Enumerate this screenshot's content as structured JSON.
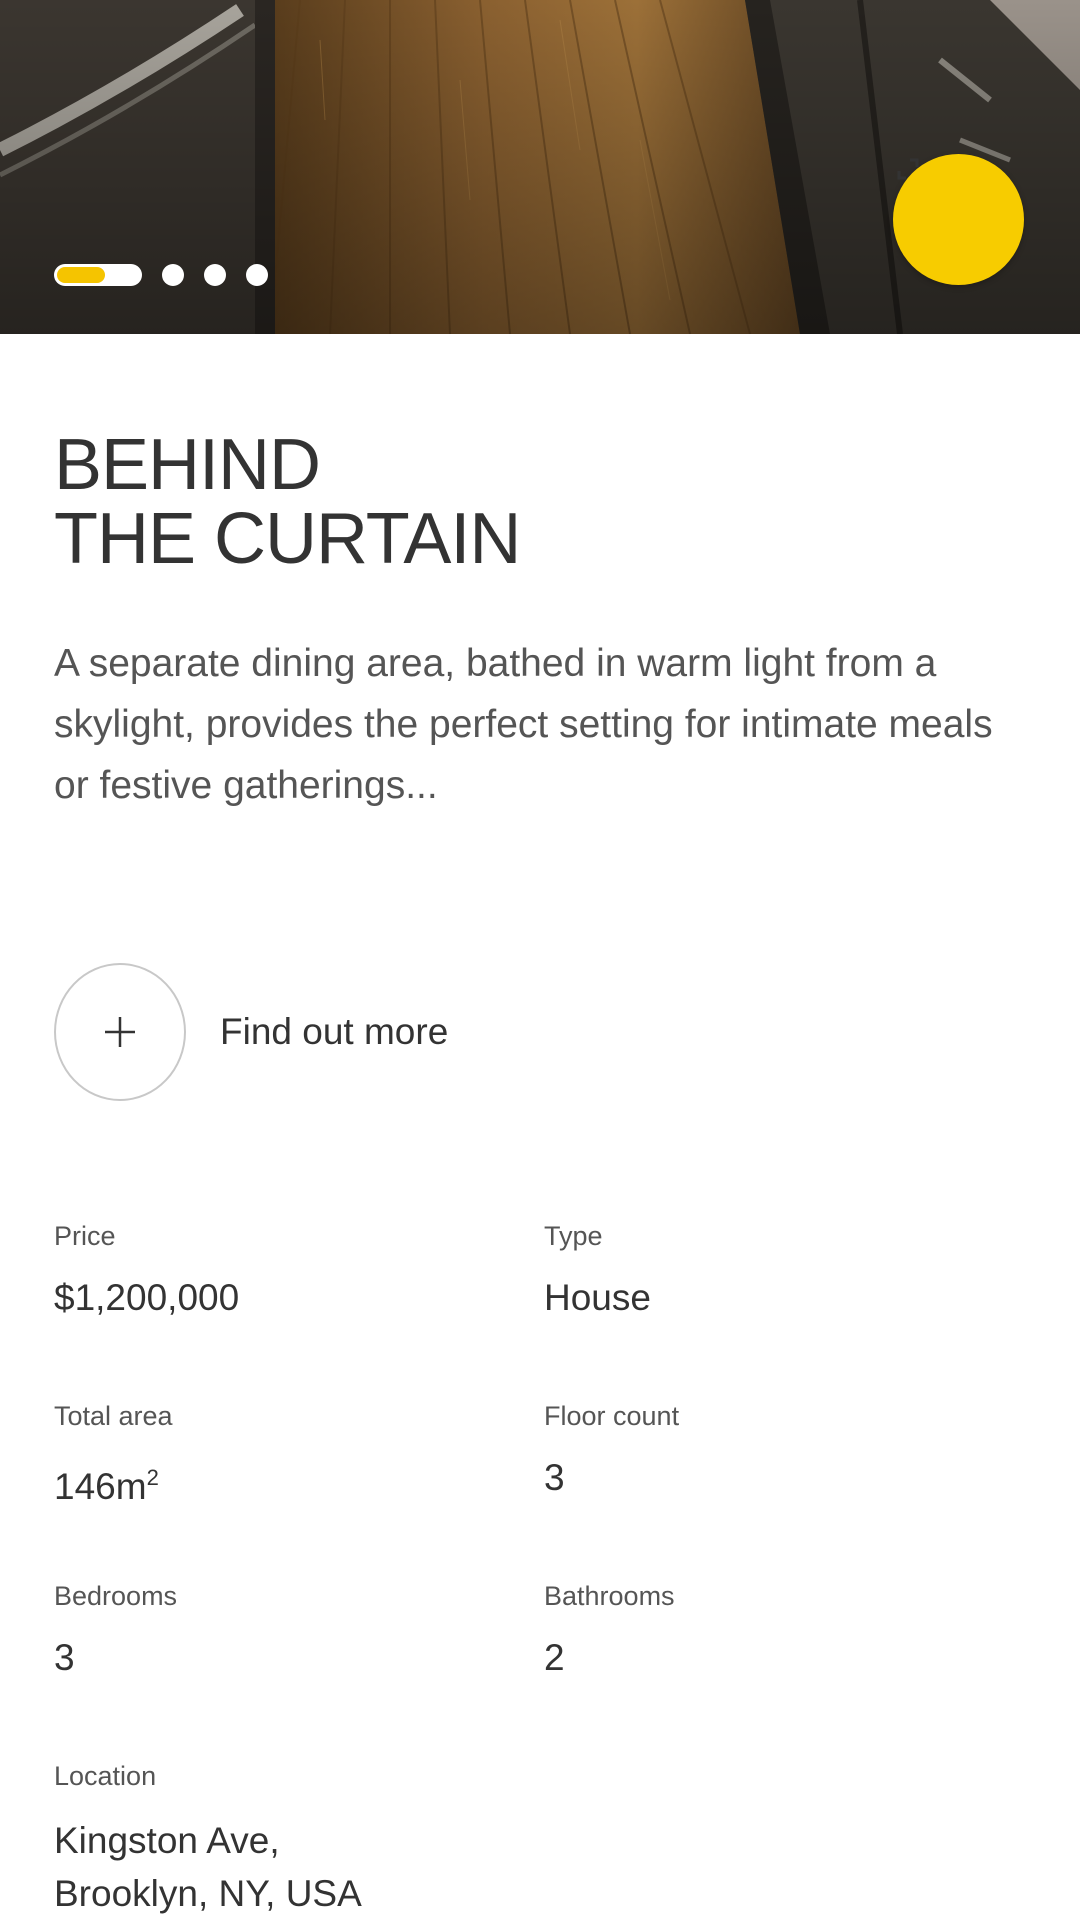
{
  "hero": {
    "image": "dining-room-hardwood-floor-photo",
    "carousel": {
      "total": 4,
      "active_index": 0,
      "active_progress": 0.55
    },
    "expand_icon": "expand-icon",
    "accent_color": "#f7cc00"
  },
  "title": {
    "line1": "BEHIND",
    "line2": "THE CURTAIN"
  },
  "description": "A separate dining area, bathed in warm light from a skylight, provides the perfect setting for intimate meals or festive gatherings...",
  "find_more": {
    "icon": "plus-icon",
    "label": "Find out more"
  },
  "specs": {
    "price": {
      "label": "Price",
      "value": "$1,200,000"
    },
    "type": {
      "label": "Type",
      "value": "House"
    },
    "total_area": {
      "label": "Total area",
      "value": "146m",
      "unit_sup": "2"
    },
    "floor_count": {
      "label": "Floor count",
      "value": "3"
    },
    "bedrooms": {
      "label": "Bedrooms",
      "value": "3"
    },
    "bathrooms": {
      "label": "Bathrooms",
      "value": "2"
    },
    "location": {
      "label": "Location",
      "line1": "Kingston Ave,",
      "line2": "Brooklyn, NY, USA"
    }
  }
}
